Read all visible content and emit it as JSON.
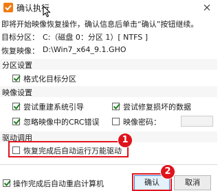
{
  "window": {
    "title": "确认执行",
    "close_glyph": "✕"
  },
  "description": {
    "line1": "即将开始映像恢复操作，确认信息后单击“确认”按钮继续。",
    "target_label": "目标分区：",
    "target_value": "C:（磁盘 0：分区 1）[ NTFS ]",
    "image_label": "恢复映像：",
    "image_value": "D:\\Win7_x64_9.1.GHO"
  },
  "partition_settings": {
    "header": "分区设置",
    "format_label": "格式化目标分区",
    "format_checked": true
  },
  "image_settings": {
    "header": "映像设置",
    "rebuild_boot_label": "尝试重建系统引导",
    "rebuild_boot_checked": true,
    "repair_data_label": "尝试修复损坏的数据",
    "repair_data_checked": true,
    "ignore_crc_label": "忽略映像中的CRC错误",
    "ignore_crc_checked": true,
    "image_password_label": "映像密码：",
    "image_password_checked": false,
    "image_password_value": ""
  },
  "driver_settings": {
    "header": "驱动调用",
    "auto_driver_label": "恢复完成后自动运行万能驱动",
    "auto_driver_checked": false
  },
  "footer": {
    "restart_label": "操作完成后自动重启计算机",
    "restart_checked": true,
    "ok_label": "确认",
    "cancel_label": "取消"
  },
  "annotations": {
    "badge1": "1",
    "badge2": "2",
    "highlight_color": "#e0131c"
  }
}
